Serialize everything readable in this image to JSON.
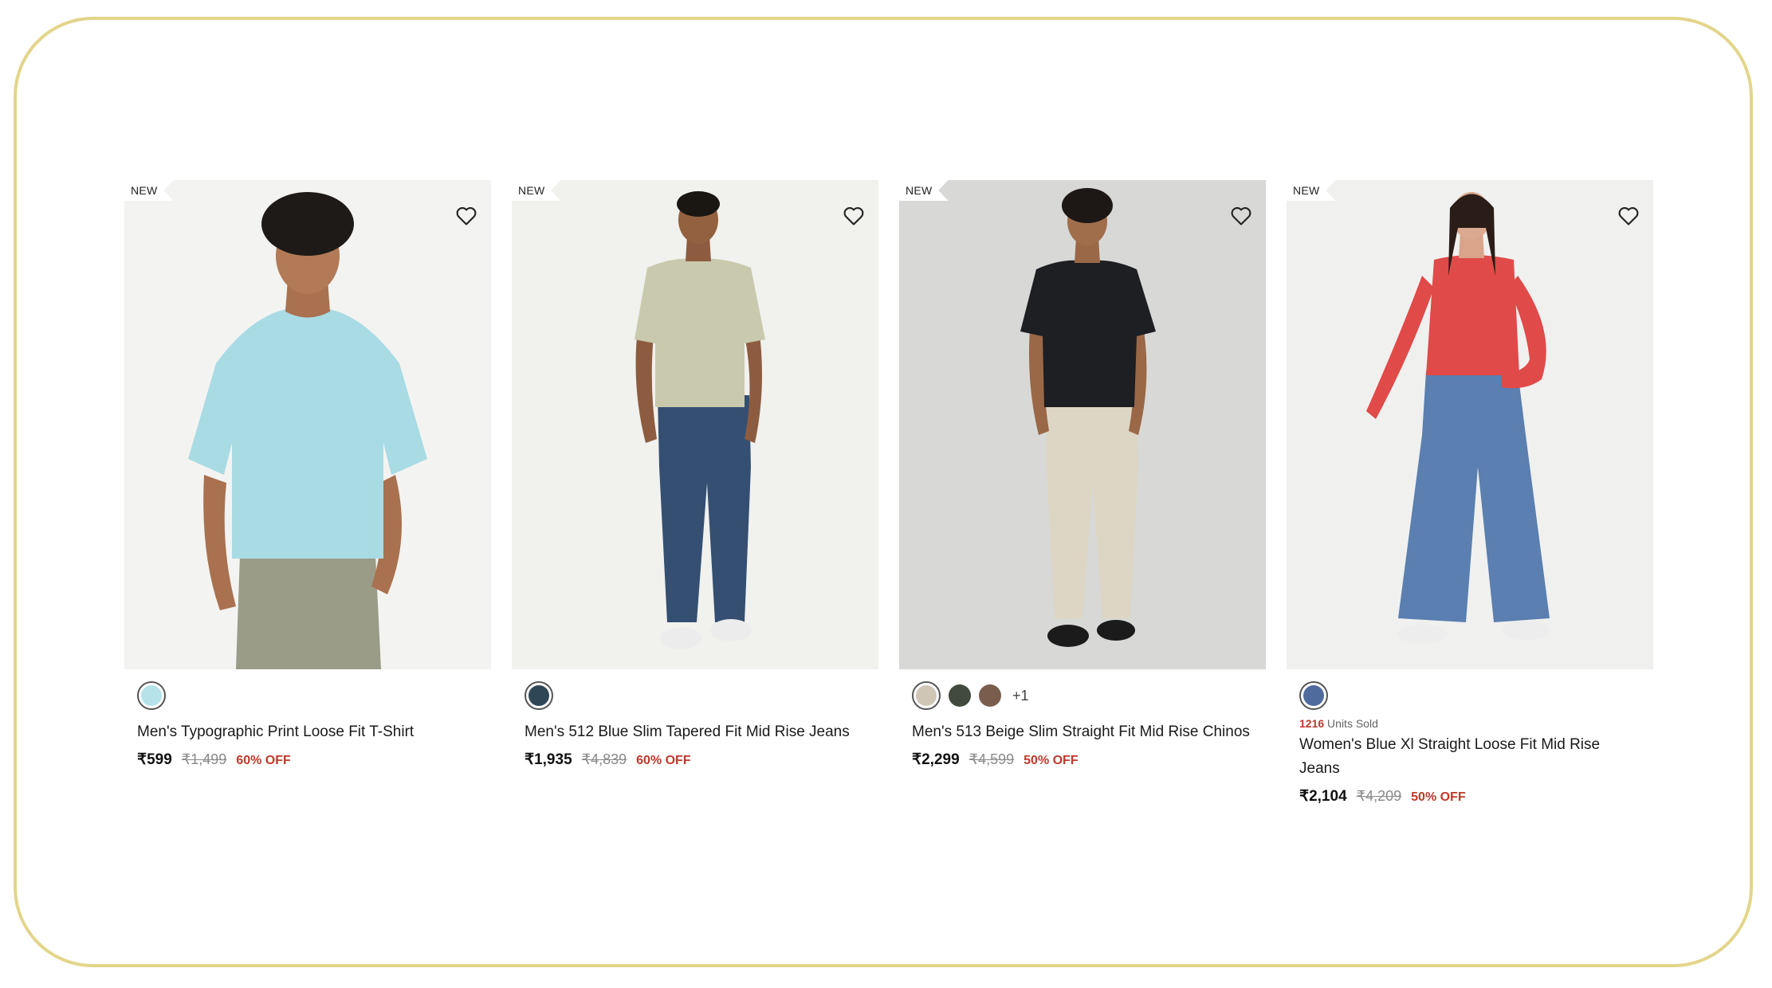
{
  "products": [
    {
      "badge": "NEW",
      "title": "Men's Typographic Print Loose Fit T-Shirt",
      "price": "₹599",
      "mrp": "₹1,499",
      "discount": "60% OFF",
      "swatches": [
        "#b6e2ea"
      ],
      "more_colors": "",
      "units_sold_count": "",
      "units_sold_label": ""
    },
    {
      "badge": "NEW",
      "title": "Men's 512 Blue Slim Tapered Fit Mid Rise Jeans",
      "price": "₹1,935",
      "mrp": "₹4,839",
      "discount": "60% OFF",
      "swatches": [
        "#2e4656"
      ],
      "more_colors": "",
      "units_sold_count": "",
      "units_sold_label": ""
    },
    {
      "badge": "NEW",
      "title": "Men's 513 Beige Slim Straight Fit Mid Rise Chinos",
      "price": "₹2,299",
      "mrp": "₹4,599",
      "discount": "50% OFF",
      "swatches": [
        "#cfc6b6",
        "#414a3c",
        "#7a5d4c"
      ],
      "more_colors": "+1",
      "units_sold_count": "",
      "units_sold_label": ""
    },
    {
      "badge": "NEW",
      "title": "Women's Blue Xl Straight Loose Fit Mid Rise Jeans",
      "price": "₹2,104",
      "mrp": "₹4,209",
      "discount": "50% OFF",
      "swatches": [
        "#4f6a9c"
      ],
      "more_colors": "",
      "units_sold_count": "1216",
      "units_sold_label": "Units Sold"
    }
  ],
  "colors": {
    "frame_border": "#e3d58a",
    "discount": "#c0392b"
  },
  "icons": {
    "wishlist": "heart-outline-icon"
  }
}
